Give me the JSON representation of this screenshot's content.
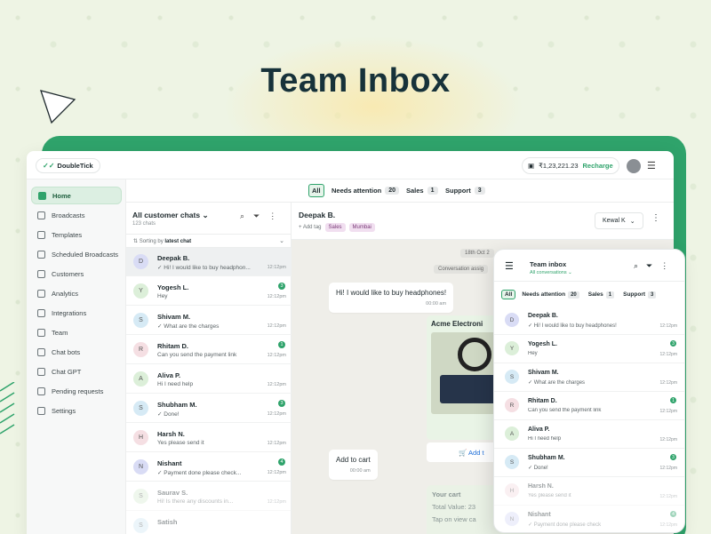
{
  "hero": {
    "title_light": "Team ",
    "title_bold": "Inbox"
  },
  "header": {
    "logo": "DoubleTick",
    "balance": "₹1,23,221.23",
    "recharge": "Recharge"
  },
  "sidebar": {
    "items": [
      {
        "label": "Home",
        "icon": "home-icon"
      },
      {
        "label": "Broadcasts",
        "icon": "megaphone-icon"
      },
      {
        "label": "Templates",
        "icon": "template-icon"
      },
      {
        "label": "Scheduled Broadcasts",
        "icon": "calendar-icon"
      },
      {
        "label": "Customers",
        "icon": "users-icon"
      },
      {
        "label": "Analytics",
        "icon": "analytics-icon"
      },
      {
        "label": "Integrations",
        "icon": "plug-icon"
      },
      {
        "label": "Team",
        "icon": "team-icon"
      },
      {
        "label": "Chat bots",
        "icon": "bot-icon"
      },
      {
        "label": "Chat GPT",
        "icon": "gpt-icon"
      },
      {
        "label": "Pending requests",
        "icon": "hourglass-icon"
      },
      {
        "label": "Settings",
        "icon": "gear-icon"
      }
    ]
  },
  "filters": {
    "all": "All",
    "needs_attention": "Needs attention",
    "needs_attention_count": "20",
    "sales": "Sales",
    "sales_count": "1",
    "support": "Support",
    "support_count": "3"
  },
  "chat_list": {
    "title": "All customer chats",
    "count": "123 chats",
    "sort_prefix": "Sorting by ",
    "sort_value": "latest chat",
    "rows": [
      {
        "initial": "D",
        "name": "Deepak B.",
        "msg": "✓ Hi! I would like to buy headphon...",
        "time": "12:12pm",
        "badge": "",
        "color": "#d9dcf5"
      },
      {
        "initial": "Y",
        "name": "Yogesh L.",
        "msg": "Hey",
        "time": "12:12pm",
        "badge": "3",
        "color": "#dcefd9"
      },
      {
        "initial": "S",
        "name": "Shivam M.",
        "msg": "✓ What are the charges",
        "time": "12:12pm",
        "badge": "",
        "color": "#d6eaf5"
      },
      {
        "initial": "R",
        "name": "Rhitam D.",
        "msg": "Can you send the payment link",
        "time": "12:12pm",
        "badge": "1",
        "color": "#f5dfe3"
      },
      {
        "initial": "A",
        "name": "Aliva P.",
        "msg": "Hi I need help",
        "time": "12:12pm",
        "badge": "",
        "color": "#dcefd9"
      },
      {
        "initial": "S",
        "name": "Shubham M.",
        "msg": "✓ Done!",
        "time": "12:12pm",
        "badge": "3",
        "color": "#d6eaf5"
      },
      {
        "initial": "H",
        "name": "Harsh N.",
        "msg": "Yes please send it",
        "time": "12:12pm",
        "badge": "",
        "color": "#f5dfe3"
      },
      {
        "initial": "N",
        "name": "Nishant",
        "msg": "✓ Payment done please check...",
        "time": "12:12pm",
        "badge": "4",
        "color": "#d9dcf5"
      },
      {
        "initial": "S",
        "name": "Saurav S.",
        "msg": "Hi! Is there any discounts in...",
        "time": "12:12pm",
        "badge": "",
        "color": "#dcefd9"
      },
      {
        "initial": "S",
        "name": "Satish",
        "msg": "",
        "time": "",
        "badge": "",
        "color": "#d6eaf5"
      }
    ]
  },
  "conversation": {
    "name": "Deepak B.",
    "add_tag": "+ Add tag",
    "tags": [
      "Sales",
      "Mumbai"
    ],
    "agent": "Kewal K",
    "date_pill": "18th Oct 2",
    "assign_pill": "Conversation assig",
    "msg1": "Hi! I would like to buy headphones!",
    "msg1_time": "00:00 am",
    "product_title": "Acme Electroni",
    "add_btn": "Add t",
    "msg2": "Add to cart",
    "msg2_time": "00:00 am",
    "cart_title": "Your cart",
    "cart_total": "Total Value: 23",
    "cart_hint": "Tap on view ca"
  },
  "mobile": {
    "title": "Team inbox",
    "sub": "All conversations ⌄",
    "tabs": {
      "all": "All",
      "needs": "Needs attention",
      "needs_count": "20",
      "sales": "Sales",
      "sales_count": "1",
      "support": "Support",
      "support_count": "3"
    },
    "rows": [
      {
        "initial": "D",
        "name": "Deepak B.",
        "msg": "✓ Hi! I would like to buy headphones!",
        "time": "12:12pm",
        "badge": "",
        "color": "#d9dcf5"
      },
      {
        "initial": "Y",
        "name": "Yogesh L.",
        "msg": "Hey",
        "time": "12:12pm",
        "badge": "3",
        "color": "#dcefd9"
      },
      {
        "initial": "S",
        "name": "Shivam M.",
        "msg": "✓ What are the charges",
        "time": "12:12pm",
        "badge": "",
        "color": "#d6eaf5"
      },
      {
        "initial": "R",
        "name": "Rhitam D.",
        "msg": "Can you send the payment link",
        "time": "12:12pm",
        "badge": "1",
        "color": "#f5dfe3"
      },
      {
        "initial": "A",
        "name": "Aliva P.",
        "msg": "Hi I need help",
        "time": "12:12pm",
        "badge": "",
        "color": "#dcefd9"
      },
      {
        "initial": "S",
        "name": "Shubham M.",
        "msg": "✓ Done!",
        "time": "12:12pm",
        "badge": "3",
        "color": "#d6eaf5"
      },
      {
        "initial": "H",
        "name": "Harsh N.",
        "msg": "Yes please send it",
        "time": "12:12pm",
        "badge": "",
        "color": "#f5dfe3"
      },
      {
        "initial": "N",
        "name": "Nishant",
        "msg": "✓ Payment done please check",
        "time": "12:12pm",
        "badge": "4",
        "color": "#d9dcf5"
      }
    ]
  },
  "colors": {
    "accent": "#2fa36b",
    "background": "#eef4e4"
  }
}
